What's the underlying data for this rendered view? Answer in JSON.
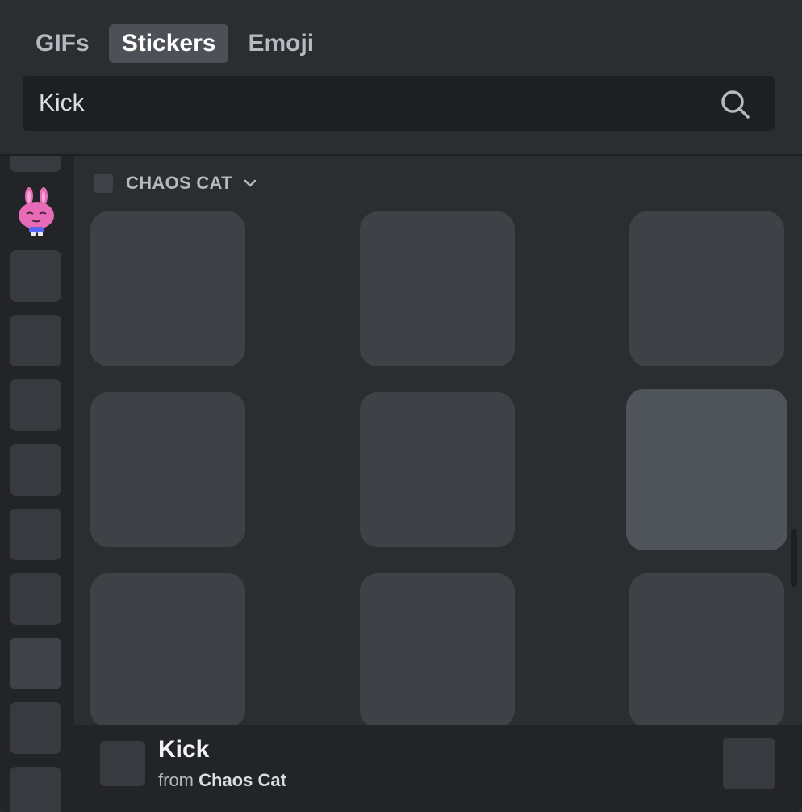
{
  "tabs": [
    {
      "label": "GIFs",
      "active": false
    },
    {
      "label": "Stickers",
      "active": true
    },
    {
      "label": "Emoji",
      "active": false
    }
  ],
  "search": {
    "value": "Kick",
    "icon": "search-icon"
  },
  "category": {
    "name": "CHAOS CAT",
    "icon": "chevron-down-icon",
    "collapsed": false
  },
  "sticker_count": 9,
  "footer": {
    "sticker_name": "Kick",
    "from_prefix": "from",
    "pack_name": "Chaos Cat"
  },
  "colors": {
    "background": "#2b2d31",
    "rail": "#232428",
    "tile": "#3f4147",
    "tile_hover": "#4f535a",
    "active_tab": "#4e5058",
    "bunny_pink": "#e86bb8"
  }
}
